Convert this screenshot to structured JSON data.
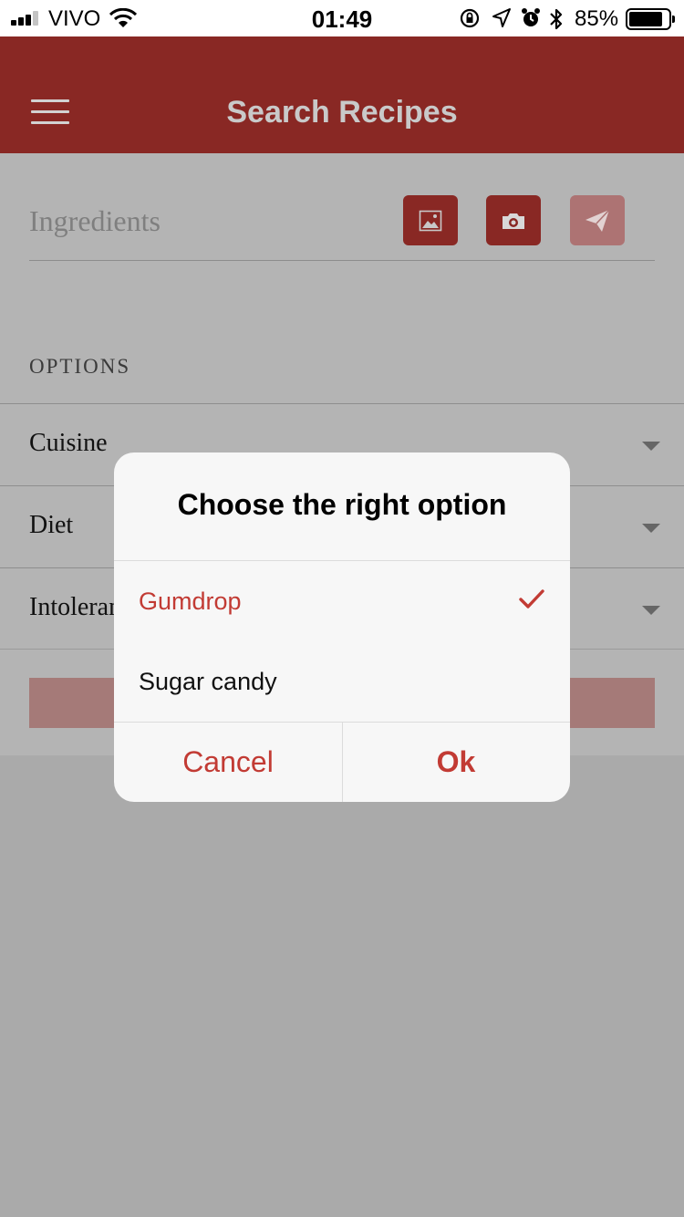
{
  "status_bar": {
    "carrier": "VIVO",
    "time": "01:49",
    "battery_percent": "85%",
    "battery_level": 0.85,
    "signal_bars": 3,
    "icons": [
      "signal-icon",
      "wifi-icon",
      "rotation-lock-icon",
      "location-icon",
      "alarm-icon",
      "bluetooth-icon",
      "battery-icon"
    ]
  },
  "header": {
    "title": "Search Recipes",
    "menu_icon": "hamburger-menu-icon",
    "color": "#892824"
  },
  "search": {
    "placeholder": "Ingredients",
    "buttons": [
      {
        "name": "gallery-button",
        "icon": "image-icon",
        "state": "active"
      },
      {
        "name": "camera-button",
        "icon": "camera-icon",
        "state": "active"
      },
      {
        "name": "send-button",
        "icon": "paper-plane-icon",
        "state": "disabled"
      }
    ]
  },
  "options": {
    "heading": "OPTIONS",
    "rows": [
      {
        "label": "Cuisine"
      },
      {
        "label": "Diet"
      },
      {
        "label": "Intoleran"
      }
    ]
  },
  "modal": {
    "title": "Choose the right option",
    "choices": [
      {
        "label": "Gumdrop",
        "selected": true
      },
      {
        "label": "Sugar candy",
        "selected": false
      }
    ],
    "cancel_label": "Cancel",
    "ok_label": "Ok",
    "accent_color": "#c23b34"
  }
}
